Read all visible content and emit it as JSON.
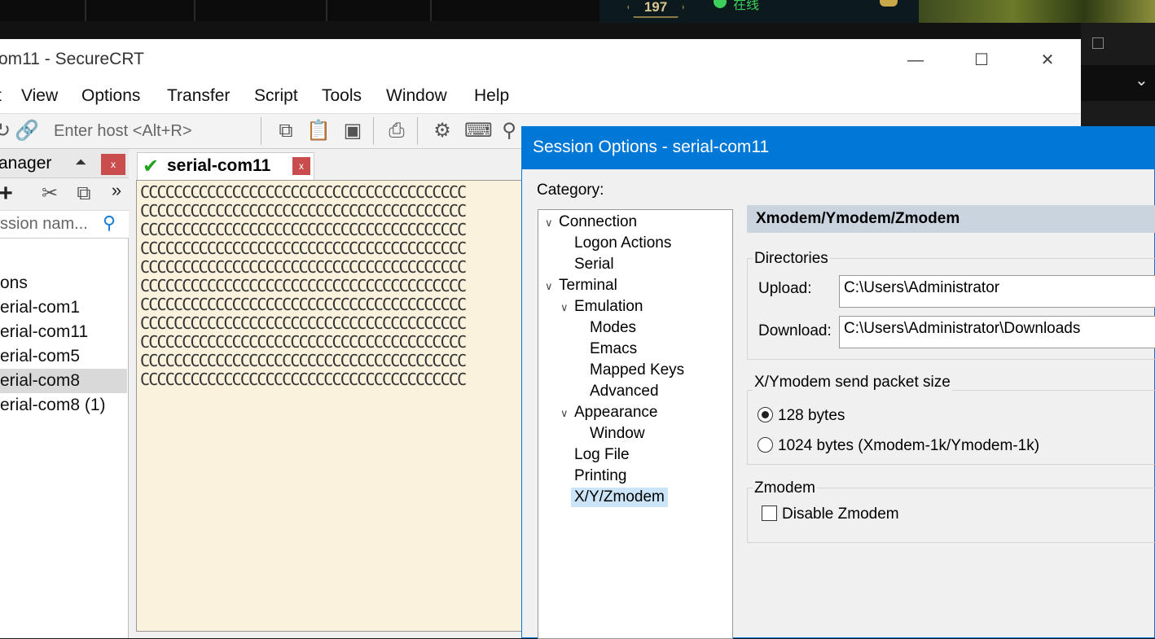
{
  "background": {
    "badge_number": "197",
    "status_text": "在线"
  },
  "window": {
    "title": "om11 - SecureCRT",
    "menu": [
      "t",
      "View",
      "Options",
      "Transfer",
      "Script",
      "Tools",
      "Window",
      "Help"
    ],
    "host_placeholder": "Enter host <Alt+R>"
  },
  "session_manager": {
    "title": "anager",
    "close_label": "x",
    "search_placeholder": "ssion nam...",
    "items": [
      "ons",
      "erial-com1",
      "erial-com11",
      "erial-com5",
      "erial-com8",
      "erial-com8 (1)"
    ],
    "selected_index": 4
  },
  "tab": {
    "label": "serial-com11",
    "close_label": "x"
  },
  "terminal": {
    "lines": [
      "CCCCCCCCCCCCCCCCCCCCCCCCCCCCCCCCCCCCCCC",
      "CCCCCCCCCCCCCCCCCCCCCCCCCCCCCCCCCCCCCCC",
      "CCCCCCCCCCCCCCCCCCCCCCCCCCCCCCCCCCCCCCC",
      "CCCCCCCCCCCCCCCCCCCCCCCCCCCCCCCCCCCCCCC",
      "CCCCCCCCCCCCCCCCCCCCCCCCCCCCCCCCCCCCCCC",
      "CCCCCCCCCCCCCCCCCCCCCCCCCCCCCCCCCCCCCCC",
      "CCCCCCCCCCCCCCCCCCCCCCCCCCCCCCCCCCCCCCC",
      "CCCCCCCCCCCCCCCCCCCCCCCCCCCCCCCCCCCCCCC",
      "CCCCCCCCCCCCCCCCCCCCCCCCCCCCCCCCCCCCCCC",
      "CCCCCCCCCCCCCCCCCCCCCCCCCCCCCCCCCCCCCCC",
      "CCCCCCCCCCCCCCCCCCCCCCCCCCCCCCCCCCCCCCC"
    ]
  },
  "dialog": {
    "title": "Session Options - serial-com11",
    "category_label": "Category:",
    "tree": {
      "connection": "Connection",
      "logon_actions": "Logon Actions",
      "serial": "Serial",
      "terminal": "Terminal",
      "emulation": "Emulation",
      "modes": "Modes",
      "emacs": "Emacs",
      "mapped_keys": "Mapped Keys",
      "advanced": "Advanced",
      "appearance": "Appearance",
      "window": "Window",
      "log_file": "Log File",
      "printing": "Printing",
      "xyzmodem": "X/Y/Zmodem"
    },
    "panel_title": "Xmodem/Ymodem/Zmodem",
    "directories": {
      "label": "Directories",
      "upload_label": "Upload:",
      "upload_value": "C:\\Users\\Administrator",
      "download_label": "Download:",
      "download_value": "C:\\Users\\Administrator\\Downloads"
    },
    "packet": {
      "label": "X/Ymodem send packet size",
      "option1": "128 bytes",
      "option2": "1024 bytes  (Xmodem-1k/Ymodem-1k)",
      "selected": "128 bytes"
    },
    "zmodem": {
      "label": "Zmodem",
      "disable_label": "Disable Zmodem",
      "disable_checked": false
    }
  },
  "colors": {
    "dialog_title_bg": "#0078d7",
    "terminal_bg": "#fbf2de",
    "close_button": "#c94d4d",
    "check_green": "#1fa31f"
  }
}
